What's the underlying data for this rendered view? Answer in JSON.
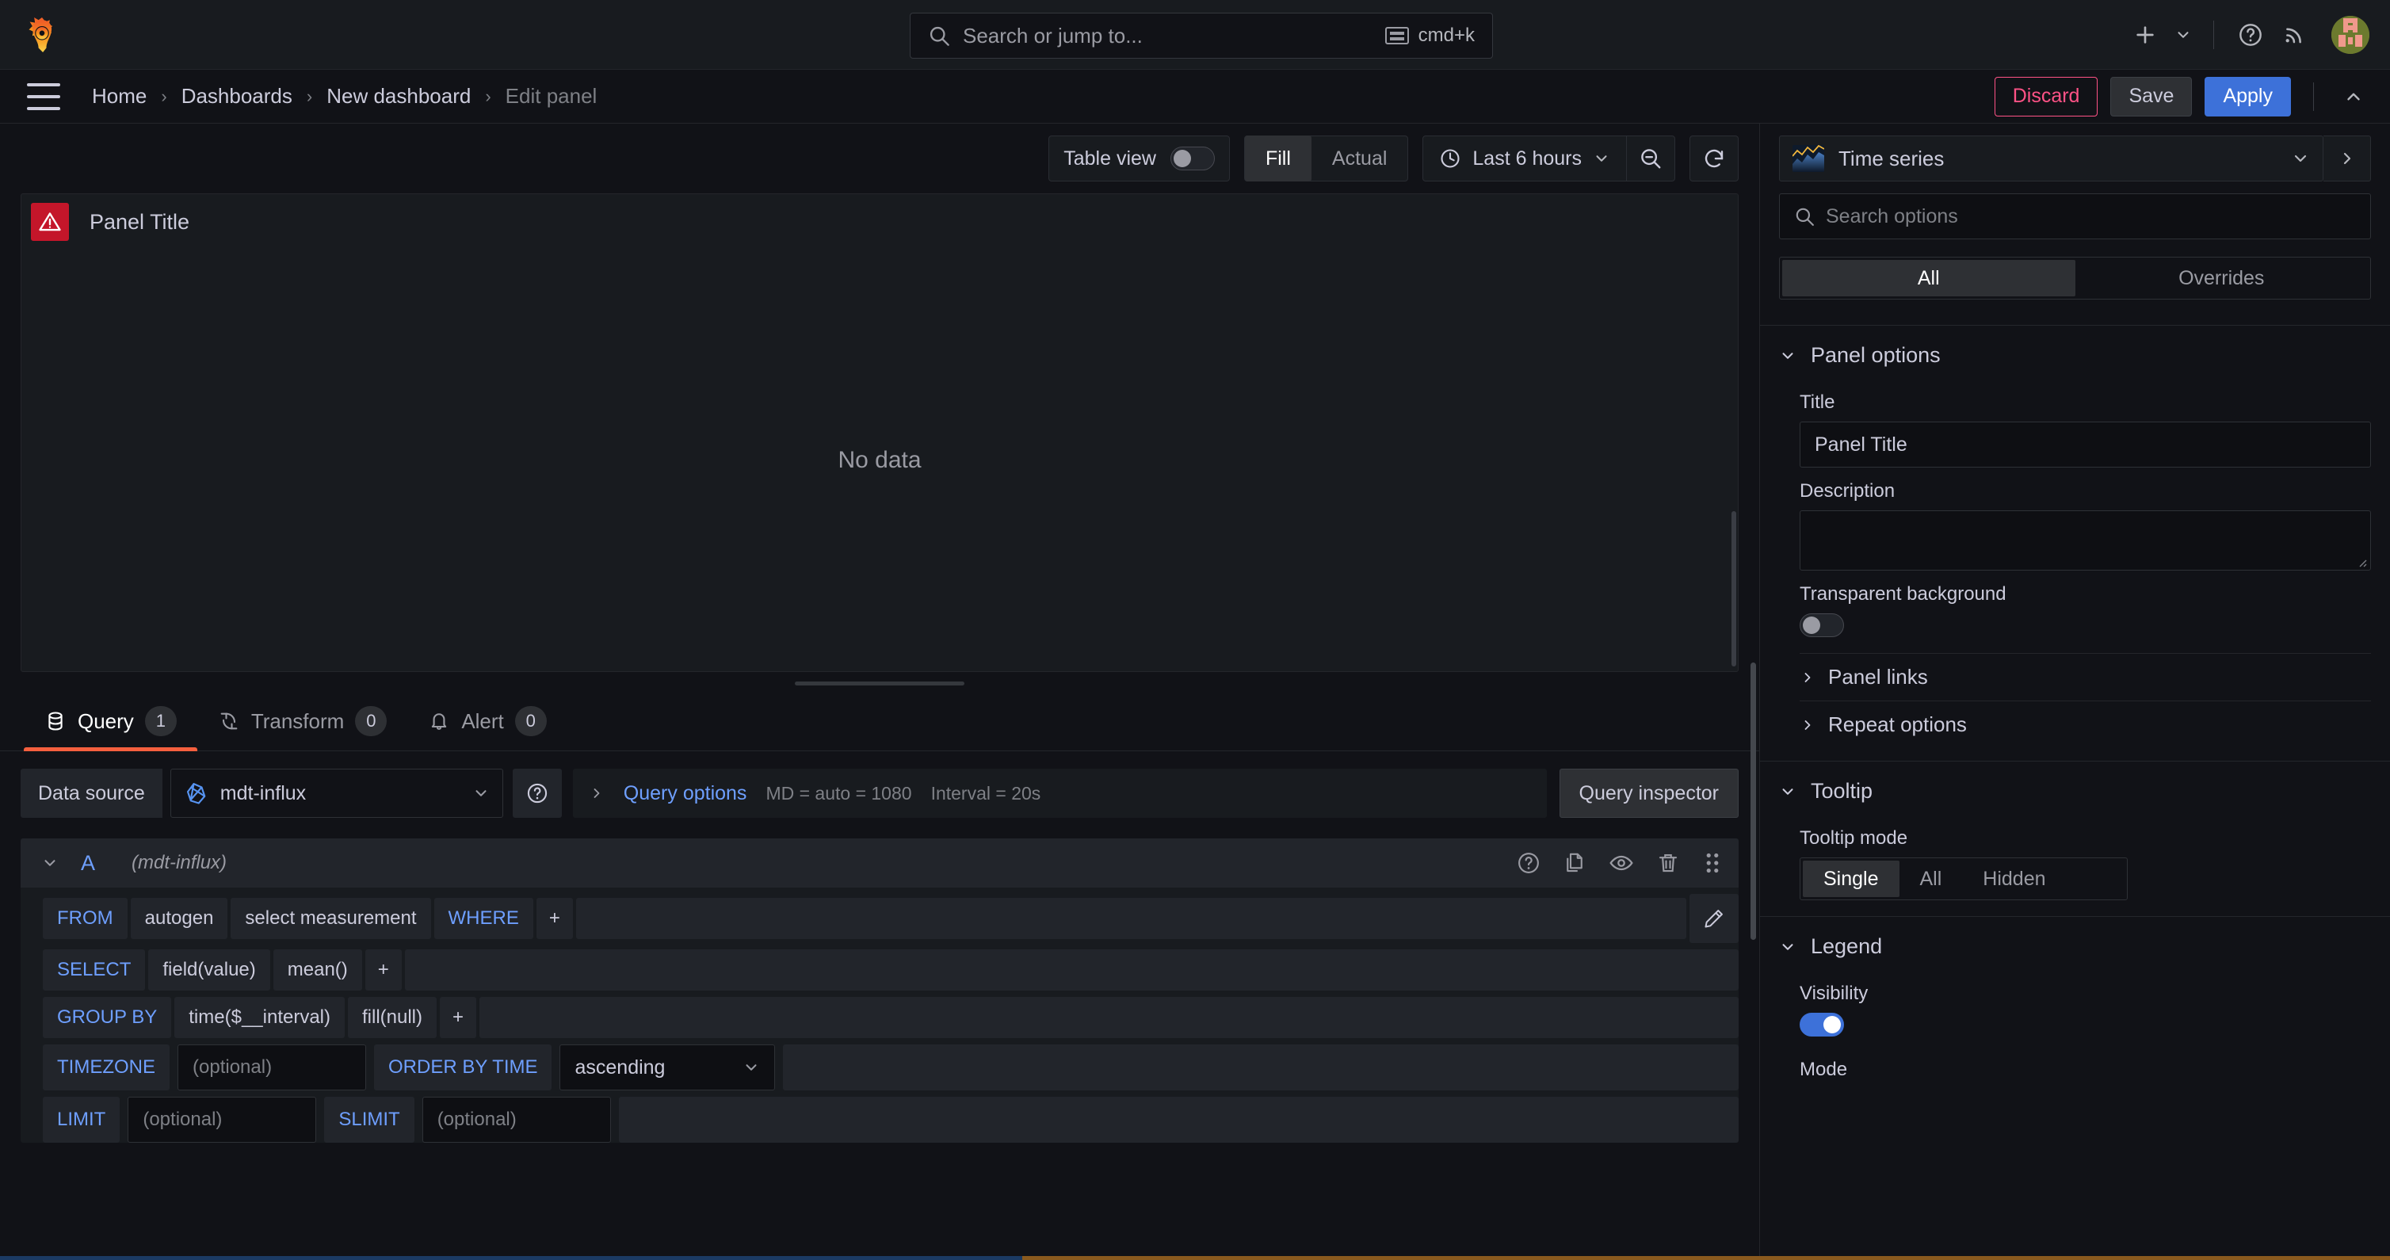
{
  "topnav": {
    "logo_icon": "grafana-logo-icon",
    "search": {
      "placeholder": "Search or jump to...",
      "shortcut": "cmd+k",
      "icon": "search-icon"
    },
    "add_icon": "plus-icon",
    "add_chevron_icon": "chevron-down-icon",
    "help_icon": "question-circle-icon",
    "news_icon": "rss-icon",
    "avatar": "user-avatar"
  },
  "breadcrumb": {
    "menu_icon": "hamburger-menu-icon",
    "items": [
      {
        "label": "Home",
        "current": false
      },
      {
        "label": "Dashboards",
        "current": false
      },
      {
        "label": "New dashboard",
        "current": false
      },
      {
        "label": "Edit panel",
        "current": true
      }
    ],
    "separator": "›",
    "actions": {
      "discard": "Discard",
      "save": "Save",
      "apply": "Apply",
      "collapse_icon": "chevron-up-icon"
    }
  },
  "panel_toolbar": {
    "table_view_label": "Table view",
    "table_view_on": false,
    "fill_actual": {
      "options": [
        "Fill",
        "Actual"
      ],
      "selected": "Fill"
    },
    "time_picker": {
      "icon": "clock-icon",
      "label": "Last 6 hours",
      "chevron": "chevron-down-icon"
    },
    "zoom_out_icon": "zoom-out-icon",
    "refresh_icon": "refresh-icon"
  },
  "panel": {
    "alert_icon": "warning-triangle-icon",
    "title": "Panel Title",
    "empty_message": "No data"
  },
  "query_tabs": [
    {
      "label": "Query",
      "count": "1",
      "icon": "database-icon",
      "active": true
    },
    {
      "label": "Transform",
      "count": "0",
      "icon": "transform-icon",
      "active": false
    },
    {
      "label": "Alert",
      "count": "0",
      "icon": "bell-icon",
      "active": false
    }
  ],
  "datasource_row": {
    "label": "Data source",
    "selected": "mdt-influx",
    "datasource_icon": "influxdb-icon",
    "chevron_icon": "chevron-down-icon",
    "help_icon": "question-circle-icon",
    "query_options_label": "Query options",
    "query_options_chevron": "chevron-right-icon",
    "max_data_points": "MD = auto = 1080",
    "interval": "Interval = 20s",
    "query_inspector": "Query inspector"
  },
  "query_a": {
    "collapse_icon": "chevron-down-icon",
    "ref_id": "A",
    "datasource": "(mdt-influx)",
    "actions": [
      {
        "icon": "help-circle-icon"
      },
      {
        "icon": "copy-icon"
      },
      {
        "icon": "eye-icon"
      },
      {
        "icon": "trash-icon"
      },
      {
        "icon": "drag-handle-icon"
      }
    ],
    "rows": {
      "from": {
        "key": "FROM",
        "policy": "autogen",
        "measurement": "select measurement",
        "where_key": "WHERE",
        "add": "+",
        "edit_icon": "pencil-icon"
      },
      "select": {
        "key": "SELECT",
        "field": "field(value)",
        "aggregate": "mean()",
        "add": "+"
      },
      "group_by": {
        "key": "GROUP BY",
        "time": "time($__interval)",
        "fill": "fill(null)",
        "add": "+"
      },
      "timezone": {
        "key": "TIMEZONE",
        "placeholder": "(optional)",
        "order_key": "ORDER BY TIME",
        "order_value": "ascending",
        "chevron_icon": "chevron-down-icon"
      },
      "limit": {
        "key": "LIMIT",
        "placeholder": "(optional)",
        "slimit_key": "SLIMIT",
        "slimit_placeholder": "(optional)"
      }
    }
  },
  "options_pane": {
    "viz_picker": {
      "icon": "time-series-thumb-icon",
      "name": "Time series",
      "chevron_icon": "chevron-down-icon",
      "expand_icon": "chevron-right-icon"
    },
    "search": {
      "placeholder": "Search options",
      "icon": "search-icon"
    },
    "filter_tabs": {
      "options": [
        "All",
        "Overrides"
      ],
      "selected": "All"
    },
    "sections": {
      "panel_options": {
        "title": "Panel options",
        "chevron_icon": "chevron-down-icon",
        "title_label": "Title",
        "title_value": "Panel Title",
        "description_label": "Description",
        "description_value": "",
        "transparent_label": "Transparent background",
        "transparent_on": false,
        "panel_links": "Panel links",
        "repeat_options": "Repeat options",
        "sub_chevron_icon": "chevron-right-icon"
      },
      "tooltip": {
        "title": "Tooltip",
        "chevron_icon": "chevron-down-icon",
        "mode_label": "Tooltip mode",
        "mode_options": [
          "Single",
          "All",
          "Hidden"
        ],
        "mode_selected": "Single"
      },
      "legend": {
        "title": "Legend",
        "chevron_icon": "chevron-down-icon",
        "visibility_label": "Visibility",
        "visibility_on": true,
        "mode_label": "Mode"
      }
    }
  },
  "colors": {
    "accent_blue": "#3d71d9",
    "accent_orange": "#f55f3e",
    "danger_pink": "#ff5286",
    "error_badge": "#c4162a",
    "link_blue": "#6e9fff",
    "bg_canvas": "#111217",
    "bg_panel": "#181b1f"
  }
}
